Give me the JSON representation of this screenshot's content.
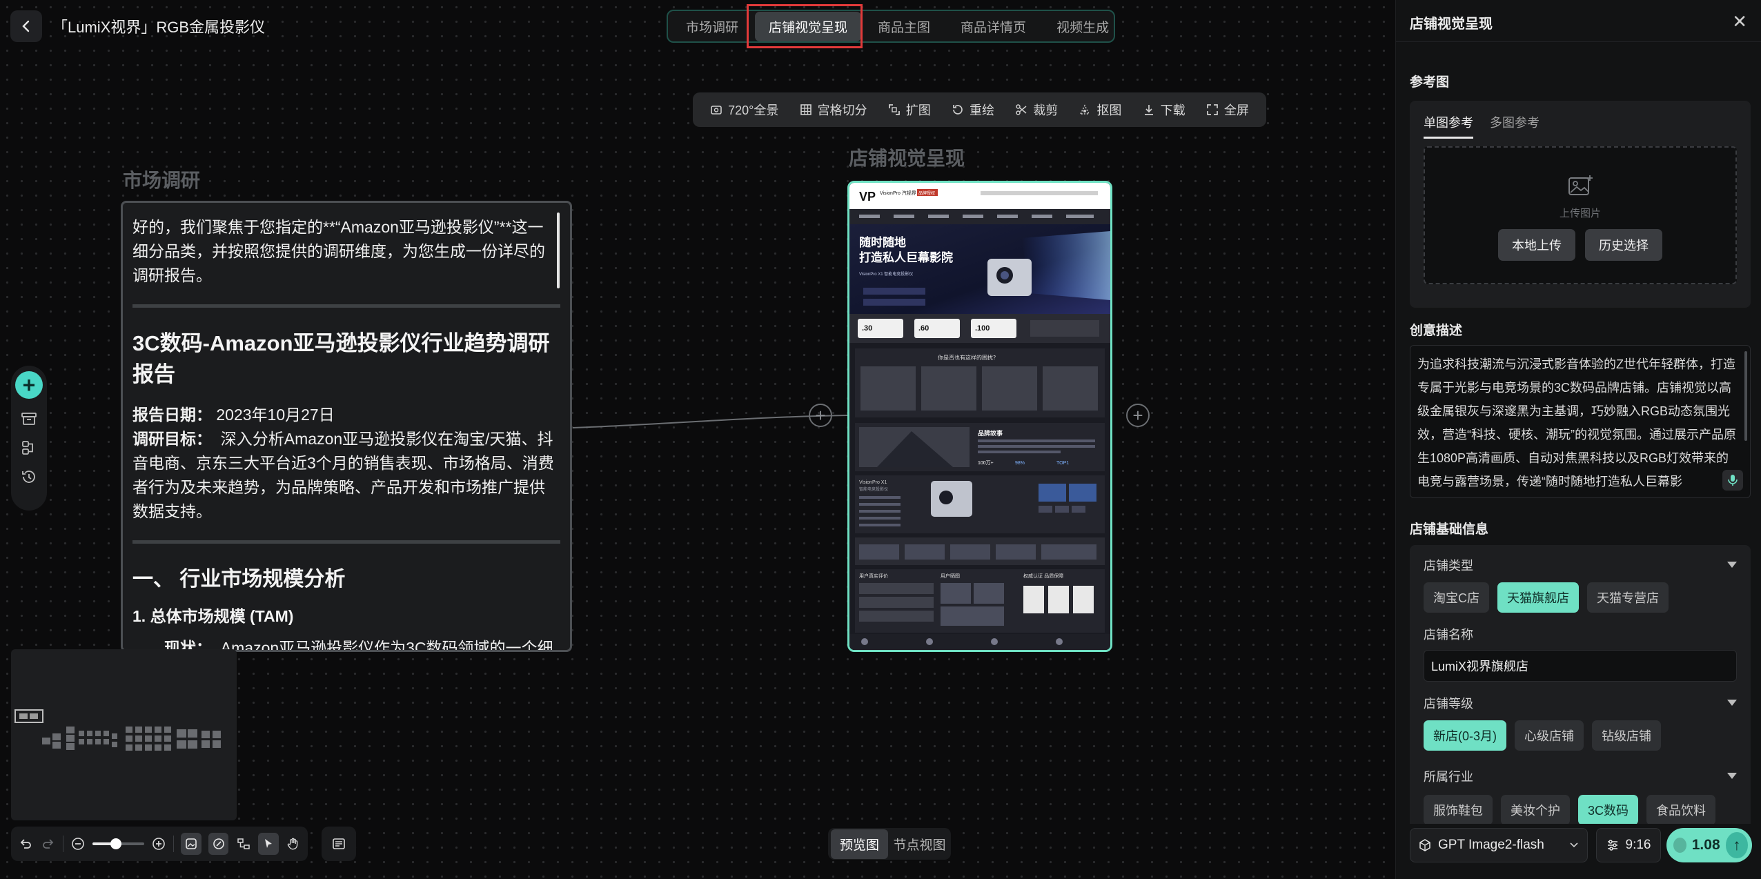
{
  "header": {
    "project_title": "「LumiX视界」RGB金属投影仪",
    "tabs": [
      {
        "label": "市场调研"
      },
      {
        "label": "店铺视觉呈现"
      },
      {
        "label": "商品主图"
      },
      {
        "label": "商品详情页"
      },
      {
        "label": "视频生成"
      }
    ],
    "active_tab": "店铺视觉呈现"
  },
  "toolbar": {
    "items": [
      {
        "label": "720°全景",
        "icon": "panorama-icon"
      },
      {
        "label": "宫格切分",
        "icon": "grid-icon"
      },
      {
        "label": "扩图",
        "icon": "expand-icon"
      },
      {
        "label": "重绘",
        "icon": "redraw-icon"
      },
      {
        "label": "裁剪",
        "icon": "scissors-icon"
      },
      {
        "label": "抠图",
        "icon": "cutout-icon"
      },
      {
        "label": "下载",
        "icon": "download-icon"
      },
      {
        "label": "全屏",
        "icon": "fullscreen-icon"
      }
    ]
  },
  "canvas": {
    "market_node": {
      "title": "市场调研",
      "intro": "好的，我们聚焦于您指定的**“Amazon亚马逊投影仪”**这一细分品类，并按照您提供的调研维度，为您生成一份详尽的调研报告。",
      "report_title": "3C数码-Amazon亚马逊投影仪行业趋势调研报告",
      "date_label": "报告日期：",
      "date_value": "2023年10月27日",
      "goal_label": "调研目标：",
      "goal_value": "深入分析Amazon亚马逊投影仪在淘宝/天猫、抖音电商、京东三大平台近3个月的销售表现、市场格局、消费者行为及未来趋势，为品牌策略、产品开发和市场推广提供数据支持。",
      "section1": "一、 行业市场规模分析",
      "sub1": "1. 总体市场规模 (TAM)",
      "status_label": "现状：",
      "status_value": "Amazon亚马逊投影仪作为3C数码领域的一个细"
    },
    "store_node": {
      "title": "店铺视觉呈现",
      "mock": {
        "brand": "VisionPro 汽视界",
        "tag": "品牌授权",
        "hero_line1": "随时随地",
        "hero_line2": "打造私人巨幕影院",
        "hero_sub": "VisionPro X1 智能电竞投影仪",
        "stats": [
          ".30",
          ".60",
          ".100"
        ],
        "question": "你是否也有这样的困扰?",
        "brand_story": "品牌故事",
        "brand_nums": [
          "100万+",
          "98%",
          "TOP1"
        ],
        "product": "VisionPro X1",
        "product_sub": "智能电竞投影仪",
        "reviews": "用户真实评价",
        "showcase": "用户晒图",
        "cert": "权威认证 品质保障"
      }
    }
  },
  "view_toggle": {
    "preview": "预览图",
    "nodes": "节点视图",
    "active": "preview"
  },
  "panel": {
    "title": "店铺视觉呈现",
    "ref_title": "参考图",
    "ref_tabs": [
      {
        "label": "单图参考"
      },
      {
        "label": "多图参考"
      }
    ],
    "upload_hint": "上传图片",
    "local_upload": "本地上传",
    "history_select": "历史选择",
    "desc_title": "创意描述",
    "desc_text": "为追求科技潮流与沉浸式影音体验的Z世代年轻群体，打造专属于光影与电竞场景的3C数码品牌店铺。店铺视觉以高级金属银灰与深邃黑为主基调，巧妙融入RGB动态氛围光效，营造“科技、硬核、潮玩”的视觉氛围。通过展示产品原生1080P高清画质、自动对焦黑科技以及RGB灯效带来的电竞与露营场景，传递“随时随地打造私人巨幕影",
    "info_title": "店铺基础信息",
    "store_type_label": "店铺类型",
    "store_types": [
      {
        "label": "淘宝C店"
      },
      {
        "label": "天猫旗舰店"
      },
      {
        "label": "天猫专营店"
      }
    ],
    "store_type_active": "天猫旗舰店",
    "store_name_label": "店铺名称",
    "store_name_value": "LumiX视界旗舰店",
    "level_label": "店铺等级",
    "levels": [
      {
        "label": "新店(0-3月)"
      },
      {
        "label": "心级店铺"
      },
      {
        "label": "钻级店铺"
      }
    ],
    "level_active": "新店(0-3月)",
    "industry_label": "所属行业",
    "industries": [
      {
        "label": "服饰鞋包"
      },
      {
        "label": "美妆个护"
      },
      {
        "label": "3C数码"
      },
      {
        "label": "食品饮料"
      }
    ],
    "industry_active": "3C数码",
    "model": "GPT Image2-flash",
    "ratio": "9:16",
    "cost": "1.08"
  },
  "colors": {
    "accent": "#6fe0c4",
    "highlight": "#e23a3a",
    "panel_bg": "#121314"
  }
}
